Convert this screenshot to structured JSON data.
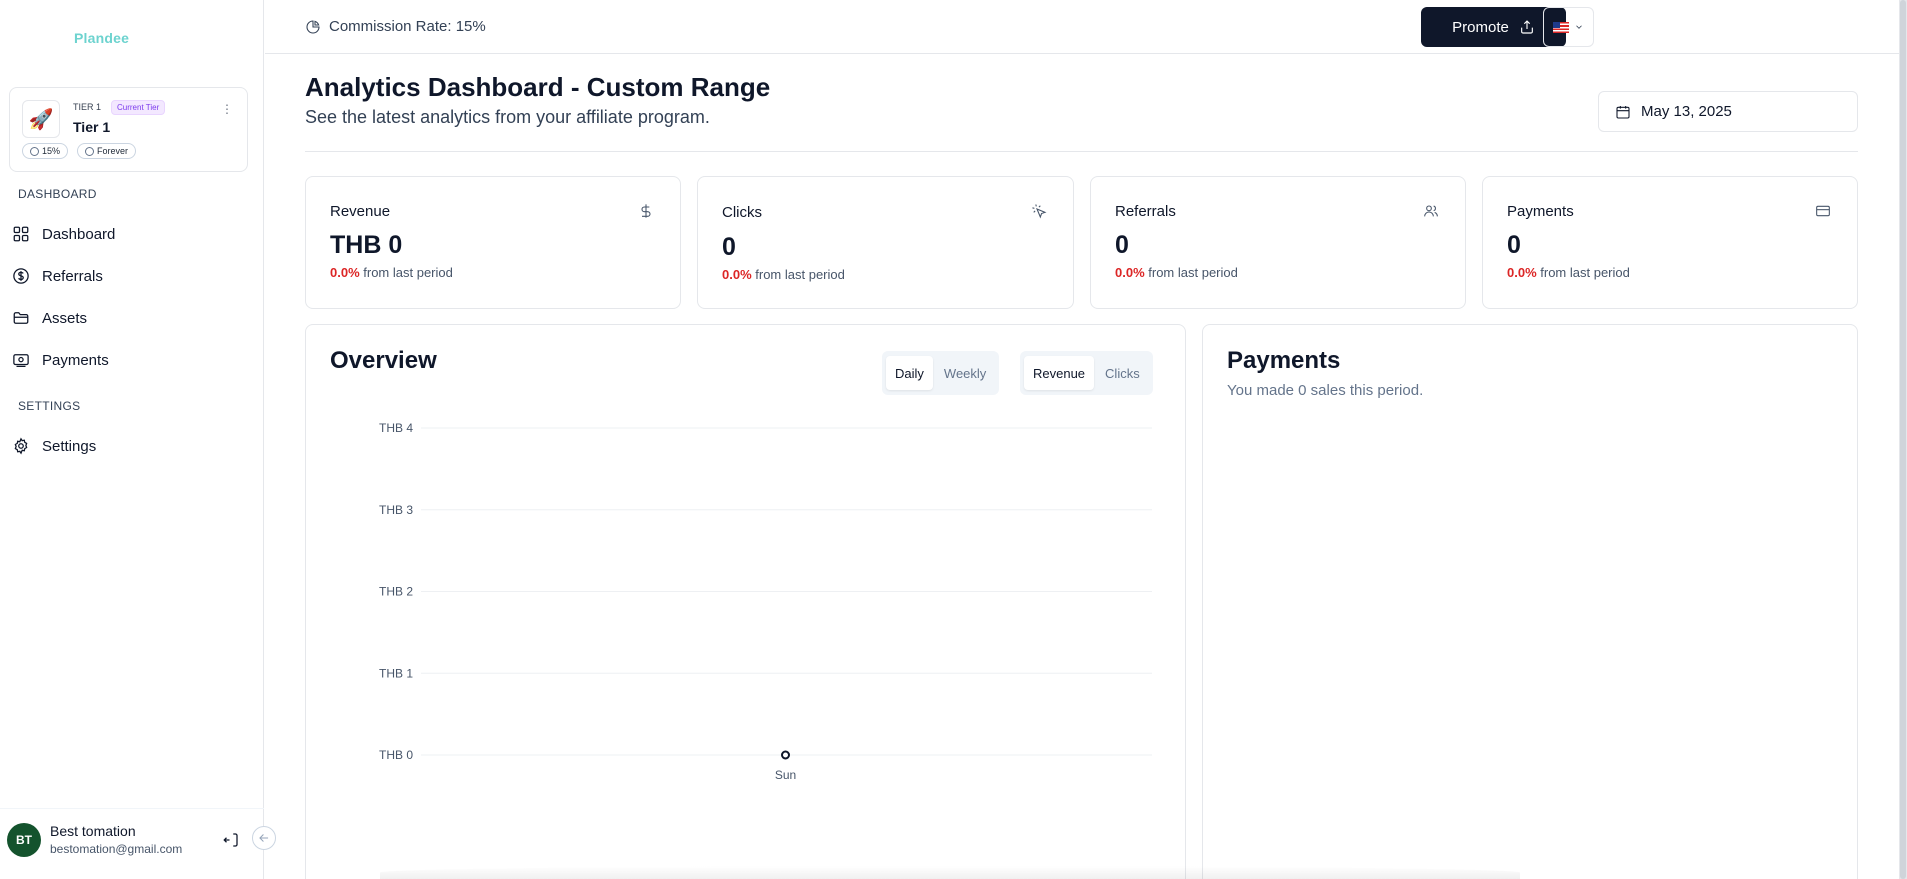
{
  "sidebar": {
    "logo": "Plandee",
    "tier": {
      "small_label": "TIER 1",
      "badge": "Current Tier",
      "name": "Tier 1",
      "rate": "15%",
      "duration": "Forever",
      "avatar_emoji": "🚀"
    },
    "sections": [
      {
        "label": "DASHBOARD"
      },
      {
        "label": "SETTINGS"
      }
    ],
    "items": [
      {
        "label": "Dashboard",
        "icon": "grid-icon"
      },
      {
        "label": "Referrals",
        "icon": "dollar-circle-icon"
      },
      {
        "label": "Assets",
        "icon": "folder-icon"
      },
      {
        "label": "Payments",
        "icon": "banknote-icon"
      },
      {
        "label": "Settings",
        "icon": "gear-icon"
      }
    ],
    "user": {
      "initials": "BT",
      "name": "Best tomation",
      "email": "bestomation@gmail.com"
    }
  },
  "topbar": {
    "commission": "Commission Rate: 15%",
    "promote_label": "Promote"
  },
  "header": {
    "title": "Analytics Dashboard - Custom Range",
    "subtitle": "See the latest analytics from your affiliate program.",
    "date": "May 13, 2025"
  },
  "stats": [
    {
      "label": "Revenue",
      "value": "THB 0",
      "change": "0.0%",
      "suffix": "from last period",
      "icon": "dollar-icon"
    },
    {
      "label": "Clicks",
      "value": "0",
      "change": "0.0%",
      "suffix": "from last period",
      "icon": "pointer-click-icon"
    },
    {
      "label": "Referrals",
      "value": "0",
      "change": "0.0%",
      "suffix": "from last period",
      "icon": "users-icon"
    },
    {
      "label": "Payments",
      "value": "0",
      "change": "0.0%",
      "suffix": "from last period",
      "icon": "credit-card-icon"
    }
  ],
  "overview": {
    "title": "Overview",
    "period_options": [
      "Daily",
      "Weekly"
    ],
    "period_selected": "Daily",
    "metric_options": [
      "Revenue",
      "Clicks"
    ],
    "metric_selected": "Revenue"
  },
  "payments_panel": {
    "title": "Payments",
    "subtitle": "You made 0 sales this period."
  },
  "colors": {
    "accent": "#0f172a",
    "negative": "#dc2626",
    "logo": "#6dd3cf"
  },
  "chart_data": {
    "type": "line",
    "x": [
      "Sun"
    ],
    "series": [
      {
        "values": [
          0
        ]
      }
    ],
    "ytick_labels": [
      "THB 0",
      "THB 1",
      "THB 2",
      "THB 3",
      "THB 4"
    ],
    "ylim": [
      0,
      4
    ],
    "grid": true,
    "title": "",
    "xlabel": "",
    "ylabel": ""
  }
}
